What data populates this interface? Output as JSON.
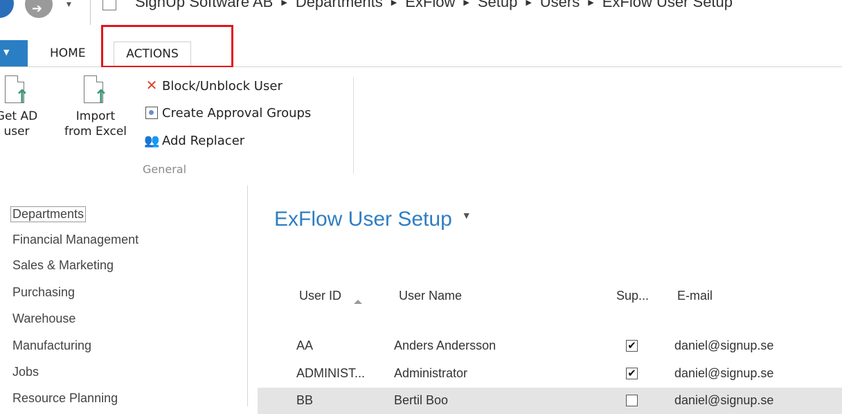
{
  "breadcrumb": [
    "SignUp Software AB",
    "Departments",
    "ExFlow",
    "Setup",
    "Users",
    "ExFlow User Setup"
  ],
  "ribbon": {
    "tabs": [
      "HOME",
      "ACTIONS"
    ],
    "get_ad_line1": "Get AD",
    "get_ad_line2": "user",
    "import_line1": "Import",
    "import_line2": "from Excel",
    "block_unblock": "Block/Unblock User",
    "create_approval_groups": "Create Approval Groups",
    "add_replacer": "Add Replacer",
    "group_label": "General"
  },
  "leftnav": {
    "items": [
      "Departments",
      "Financial Management",
      "Sales & Marketing",
      "Purchasing",
      "Warehouse",
      "Manufacturing",
      "Jobs",
      "Resource Planning"
    ]
  },
  "main": {
    "title": "ExFlow User Setup",
    "columns": {
      "user_id": "User ID",
      "user_name": "User Name",
      "sup": "Sup...",
      "email": "E-mail"
    },
    "rows": [
      {
        "id": "AA",
        "name": "Anders Andersson",
        "sup": "✔",
        "email": "daniel@signup.se"
      },
      {
        "id": "ADMINIST...",
        "name": "Administrator",
        "sup": "✔",
        "email": "daniel@signup.se"
      },
      {
        "id": "BB",
        "name": "Bertil Boo",
        "sup": "",
        "email": "daniel@signup.se"
      }
    ]
  },
  "colors": {
    "accent": "#2f7ec3",
    "highlight": "#e3141b",
    "file_tab": "#2a7ec4"
  }
}
